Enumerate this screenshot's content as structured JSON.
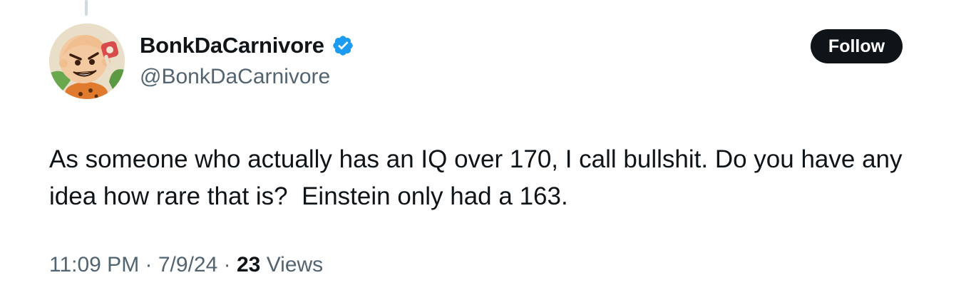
{
  "tweet": {
    "author": {
      "display_name": "BonkDaCarnivore",
      "handle": "@BonkDaCarnivore",
      "verified": true,
      "avatar_icon": "cartoon-caveman-avatar"
    },
    "follow_label": "Follow",
    "text": "As someone who actually has an IQ over 170, I call bullshit. Do you have any idea how rare that is?  Einstein only had a 163.",
    "time": "11:09 PM",
    "date": "7/9/24",
    "separator": "·",
    "views_count": "23",
    "views_label": "Views"
  },
  "colors": {
    "text_primary": "#0f1419",
    "text_secondary": "#536471",
    "verified_blue": "#1d9bf0",
    "button_bg": "#0f1419",
    "button_text": "#ffffff"
  }
}
